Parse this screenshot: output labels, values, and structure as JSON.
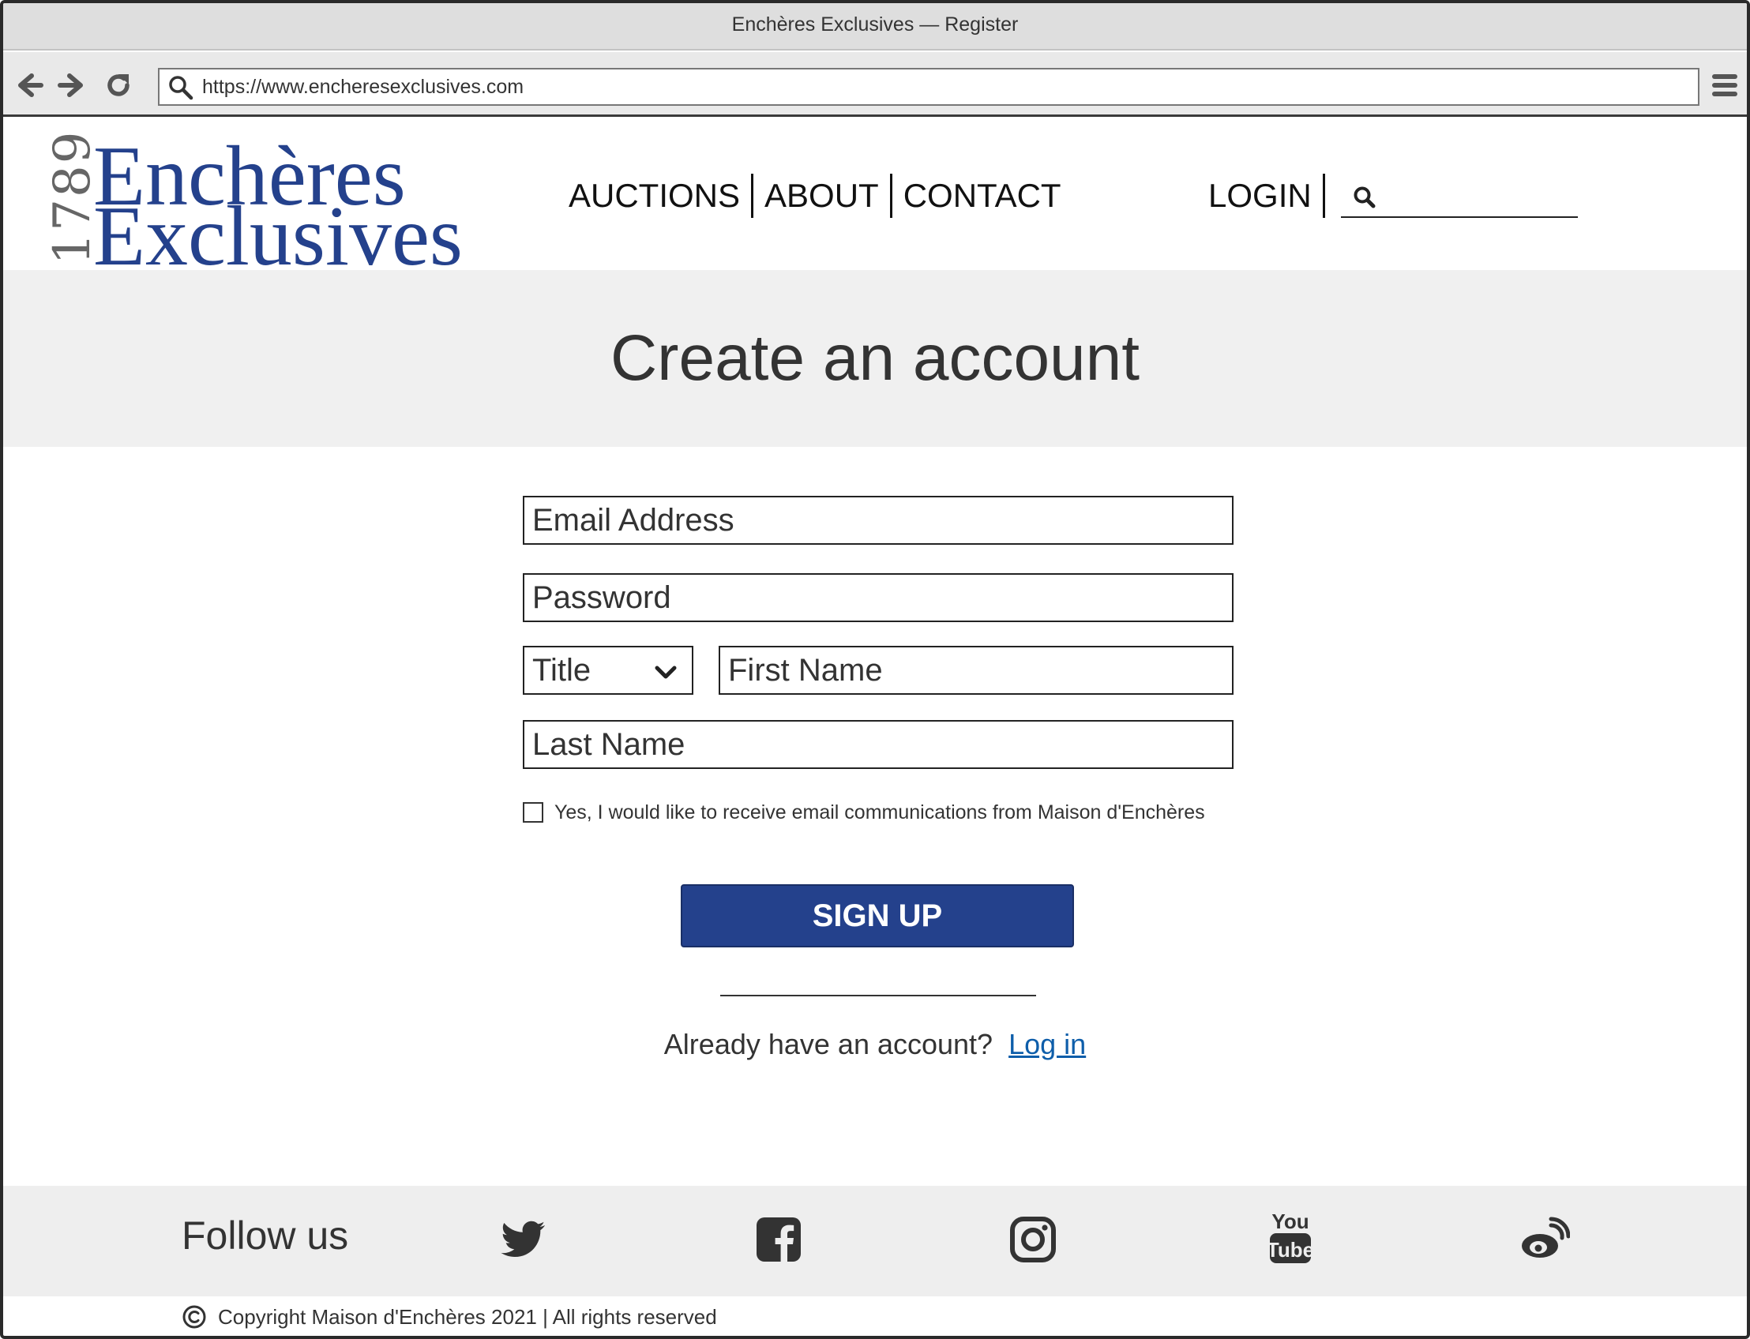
{
  "window": {
    "title": "Enchères Exclusives — Register"
  },
  "browser": {
    "url": "https://www.encheresexclusives.com",
    "icons": [
      "back-arrow-icon",
      "forward-arrow-icon",
      "reload-icon",
      "search-icon",
      "hamburger-menu-icon"
    ]
  },
  "logo": {
    "year": "1789",
    "line1": "Enchères",
    "line2": "Exclusives",
    "color": "#24418c"
  },
  "nav": {
    "items": [
      "AUCTIONS",
      "ABOUT",
      "CONTACT"
    ],
    "login": "LOGIN",
    "search_value": ""
  },
  "hero": {
    "title": "Create an account"
  },
  "form": {
    "email_placeholder": "Email Address",
    "password_placeholder": "Password",
    "title_select": "Title",
    "first_name_placeholder": "First Name",
    "last_name_placeholder": "Last Name",
    "consent_label": "Yes, I would like to receive email communications from Maison d'Enchères",
    "consent_checked": false,
    "submit_label": "SIGN UP",
    "accent_color": "#24418c"
  },
  "login_prompt": {
    "text": "Already have an account?",
    "link": "Log in"
  },
  "footer": {
    "follow_label": "Follow us",
    "social_icons": [
      "twitter-icon",
      "facebook-icon",
      "instagram-icon",
      "youtube-icon",
      "weibo-icon"
    ],
    "copyright": "Copyright Maison d'Enchères 2021 | All rights reserved"
  }
}
